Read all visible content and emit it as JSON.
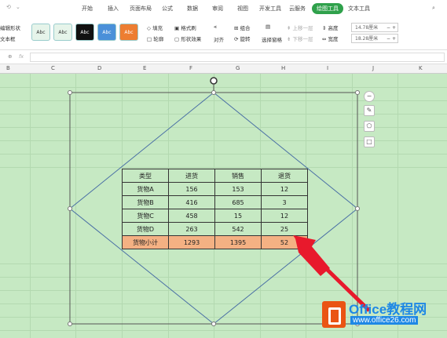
{
  "ribbon": {
    "tabs": [
      "开始",
      "插入",
      "页面布局",
      "公式",
      "数据",
      "审阅",
      "视图",
      "开发工具",
      "云服务",
      "绘图工具",
      "文本工具"
    ],
    "active_tab": "绘图工具",
    "left_labels": [
      "编辑形状",
      "文本框"
    ],
    "style_buttons": [
      {
        "label": "Abc",
        "bg": "#e6f4ea",
        "color": "#333"
      },
      {
        "label": "Abc",
        "bg": "#e6f4ea",
        "color": "#333"
      },
      {
        "label": "Abc",
        "bg": "#111111",
        "color": "#fff"
      },
      {
        "label": "Abc",
        "bg": "#4a90d9",
        "color": "#fff"
      },
      {
        "label": "Abc",
        "bg": "#ed7d31",
        "color": "#fff"
      }
    ],
    "fill_label": "填充",
    "format_brush_label": "格式刷",
    "outline_label": "轮廓",
    "shape_effect_label": "形状效果",
    "align_label": "对齐",
    "group_label": "组合",
    "rotate_label": "旋转",
    "select_pane_label": "选择窗格",
    "move_up_label": "上移一层",
    "move_down_label": "下移一层",
    "height_label": "高度",
    "height_value": "14.78厘米",
    "width_label": "宽度",
    "width_value": "18.28厘米"
  },
  "formula_bar": {
    "fx": "fx"
  },
  "columns": [
    "B",
    "C",
    "D",
    "E",
    "F",
    "G",
    "H",
    "I",
    "J",
    "K"
  ],
  "table": {
    "headers": [
      "类型",
      "进货",
      "销售",
      "退货"
    ],
    "rows": [
      [
        "货物A",
        "156",
        "153",
        "12"
      ],
      [
        "货物B",
        "416",
        "685",
        "3"
      ],
      [
        "货物C",
        "458",
        "15",
        "12"
      ],
      [
        "货物D",
        "263",
        "542",
        "25"
      ]
    ],
    "total": [
      "货物小计",
      "1293",
      "1395",
      "52"
    ],
    "total_color": "#f4b183"
  },
  "colors": {
    "sheet_bg": "#c6e9c3",
    "active_tab": "#2fa14b",
    "arrow": "#e8192c",
    "watermark_blue": "#1e88e5"
  },
  "watermark": {
    "brand": "Office教程网",
    "url": "www.office26.com"
  }
}
